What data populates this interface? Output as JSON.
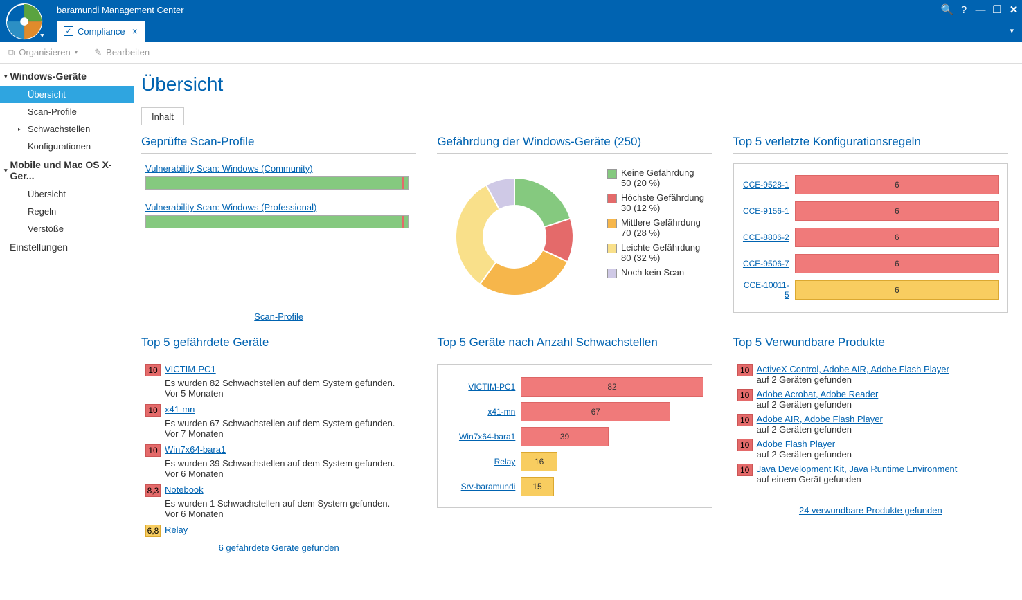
{
  "app": {
    "title": "baramundi Management Center"
  },
  "tab": {
    "label": "Compliance"
  },
  "toolbar": {
    "organize": "Organisieren",
    "edit": "Bearbeiten"
  },
  "sidebar": {
    "sec1": "Windows-Geräte",
    "items1": [
      "Übersicht",
      "Scan-Profile",
      "Schwachstellen",
      "Konfigurationen"
    ],
    "sec2": "Mobile und Mac OS X-Ger...",
    "items2": [
      "Übersicht",
      "Regeln",
      "Verstöße"
    ],
    "sec3": "Einstellungen"
  },
  "page": {
    "title": "Übersicht",
    "innertab": "Inhalt"
  },
  "scan_profiles": {
    "title": "Geprüfte Scan-Profile",
    "items": [
      {
        "name": "Vulnerability Scan: Windows (Community)"
      },
      {
        "name": "Vulnerability Scan: Windows (Professional)"
      }
    ],
    "footer": "Scan-Profile"
  },
  "risk": {
    "title": "Gefährdung der Windows-Geräte (250)",
    "legend": [
      {
        "color": "#85c97f",
        "label": "Keine Gefährdung",
        "detail": "50 (20 %)"
      },
      {
        "color": "#e46a6a",
        "label": "Höchste Gefährdung",
        "detail": "30 (12 %)"
      },
      {
        "color": "#f6b64b",
        "label": "Mittlere Gefährdung",
        "detail": "70 (28 %)"
      },
      {
        "color": "#f9e08a",
        "label": "Leichte Gefährdung",
        "detail": "80 (32 %)"
      },
      {
        "color": "#cfc9e6",
        "label": "Noch kein Scan",
        "detail": ""
      }
    ]
  },
  "rules": {
    "title": "Top 5 verletzte Konfigurationsregeln",
    "rows": [
      {
        "label": "CCE-9528-1",
        "val": "6",
        "yellow": false
      },
      {
        "label": "CCE-9156-1",
        "val": "6",
        "yellow": false
      },
      {
        "label": "CCE-8806-2",
        "val": "6",
        "yellow": false
      },
      {
        "label": "CCE-9506-7",
        "val": "6",
        "yellow": false
      },
      {
        "label": "CCE-10011-5",
        "val": "6",
        "yellow": true
      }
    ]
  },
  "devices": {
    "title": "Top 5 gefährdete Geräte",
    "rows": [
      {
        "score": "10",
        "name": "VICTIM-PC1",
        "l1": "Es wurden 82 Schwachstellen auf dem System gefunden.",
        "l2": "Vor 5 Monaten"
      },
      {
        "score": "10",
        "name": "x41-mn",
        "l1": "Es wurden 67 Schwachstellen auf dem System gefunden.",
        "l2": "Vor 7 Monaten"
      },
      {
        "score": "10",
        "name": "Win7x64-bara1",
        "l1": "Es wurden 39 Schwachstellen auf dem System gefunden.",
        "l2": "Vor 6 Monaten"
      },
      {
        "score": "8,3",
        "name": "Notebook",
        "l1": "Es wurden 1 Schwachstellen auf dem System gefunden.",
        "l2": "Vor 6 Monaten"
      },
      {
        "score": "6,8",
        "name": "Relay",
        "l1": "",
        "l2": "",
        "yellow": true
      }
    ],
    "footer": "6 gefährdete Geräte gefunden"
  },
  "dev_bars": {
    "title": "Top 5 Geräte nach Anzahl Schwachstellen",
    "rows": [
      {
        "label": "VICTIM-PC1",
        "val": 82,
        "yellow": false
      },
      {
        "label": "x41-mn",
        "val": 67,
        "yellow": false
      },
      {
        "label": "Win7x64-bara1",
        "val": 39,
        "yellow": false
      },
      {
        "label": "Relay",
        "val": 16,
        "yellow": true
      },
      {
        "label": "Srv-baramundi",
        "val": 15,
        "yellow": true
      }
    ],
    "max": 82
  },
  "products": {
    "title": "Top 5 Verwundbare Produkte",
    "rows": [
      {
        "score": "10",
        "name": "ActiveX Control, Adobe AIR, Adobe Flash Player",
        "sub": "auf 2 Geräten gefunden"
      },
      {
        "score": "10",
        "name": "Adobe Acrobat, Adobe Reader",
        "sub": "auf 2 Geräten gefunden"
      },
      {
        "score": "10",
        "name": "Adobe AIR, Adobe Flash Player",
        "sub": "auf 2 Geräten gefunden"
      },
      {
        "score": "10",
        "name": "Adobe Flash Player",
        "sub": "auf 2 Geräten gefunden"
      },
      {
        "score": "10",
        "name": "Java Development Kit, Java Runtime Environment",
        "sub": "auf einem Gerät gefunden"
      }
    ],
    "footer": "24 verwundbare Produkte gefunden"
  },
  "chart_data": [
    {
      "type": "pie",
      "title": "Gefährdung der Windows-Geräte (250)",
      "series": [
        {
          "name": "Keine Gefährdung",
          "value": 50,
          "pct": 20,
          "color": "#85c97f"
        },
        {
          "name": "Höchste Gefährdung",
          "value": 30,
          "pct": 12,
          "color": "#e46a6a"
        },
        {
          "name": "Mittlere Gefährdung",
          "value": 70,
          "pct": 28,
          "color": "#f6b64b"
        },
        {
          "name": "Leichte Gefährdung",
          "value": 80,
          "pct": 32,
          "color": "#f9e08a"
        },
        {
          "name": "Noch kein Scan",
          "value": 20,
          "pct": 8,
          "color": "#cfc9e6"
        }
      ]
    },
    {
      "type": "bar",
      "title": "Top 5 verletzte Konfigurationsregeln",
      "categories": [
        "CCE-9528-1",
        "CCE-9156-1",
        "CCE-8806-2",
        "CCE-9506-7",
        "CCE-10011-5"
      ],
      "values": [
        6,
        6,
        6,
        6,
        6
      ]
    },
    {
      "type": "bar",
      "title": "Top 5 Geräte nach Anzahl Schwachstellen",
      "categories": [
        "VICTIM-PC1",
        "x41-mn",
        "Win7x64-bara1",
        "Relay",
        "Srv-baramundi"
      ],
      "values": [
        82,
        67,
        39,
        16,
        15
      ]
    }
  ]
}
